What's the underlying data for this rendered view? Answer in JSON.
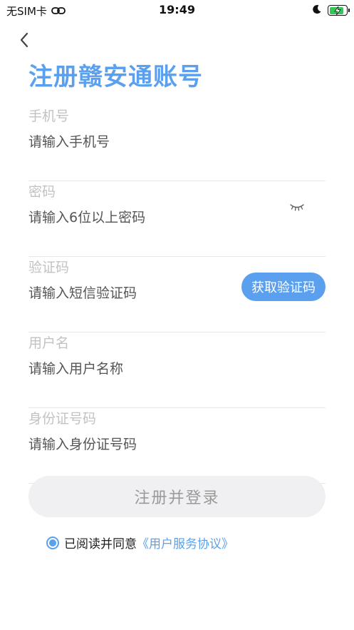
{
  "status_bar": {
    "carrier": "无SIM卡",
    "time": "19:49",
    "battery_level": 0.85,
    "battery_color": "#34c759"
  },
  "header": {
    "back_icon": "chevron-left-icon",
    "title": "注册赣安通账号"
  },
  "form": {
    "phone": {
      "label": "手机号",
      "placeholder": "请输入手机号"
    },
    "password": {
      "label": "密码",
      "placeholder": "请输入6位以上密码",
      "toggle_icon": "eye-closed-icon"
    },
    "code": {
      "label": "验证码",
      "placeholder": "请输入短信验证码",
      "button_label": "获取验证码"
    },
    "username": {
      "label": "用户名",
      "placeholder": "请输入用户名称"
    },
    "id_number": {
      "label": "身份证号码",
      "placeholder": "请输入身份证号码"
    }
  },
  "submit": {
    "label": "注册并登录"
  },
  "agreement": {
    "checked": true,
    "text": "已阅读并同意",
    "link": "《用户服务协议》"
  },
  "colors": {
    "accent": "#5aa0ee",
    "label_gray": "#c2c2c2",
    "button_bg": "#f0f0f3"
  }
}
